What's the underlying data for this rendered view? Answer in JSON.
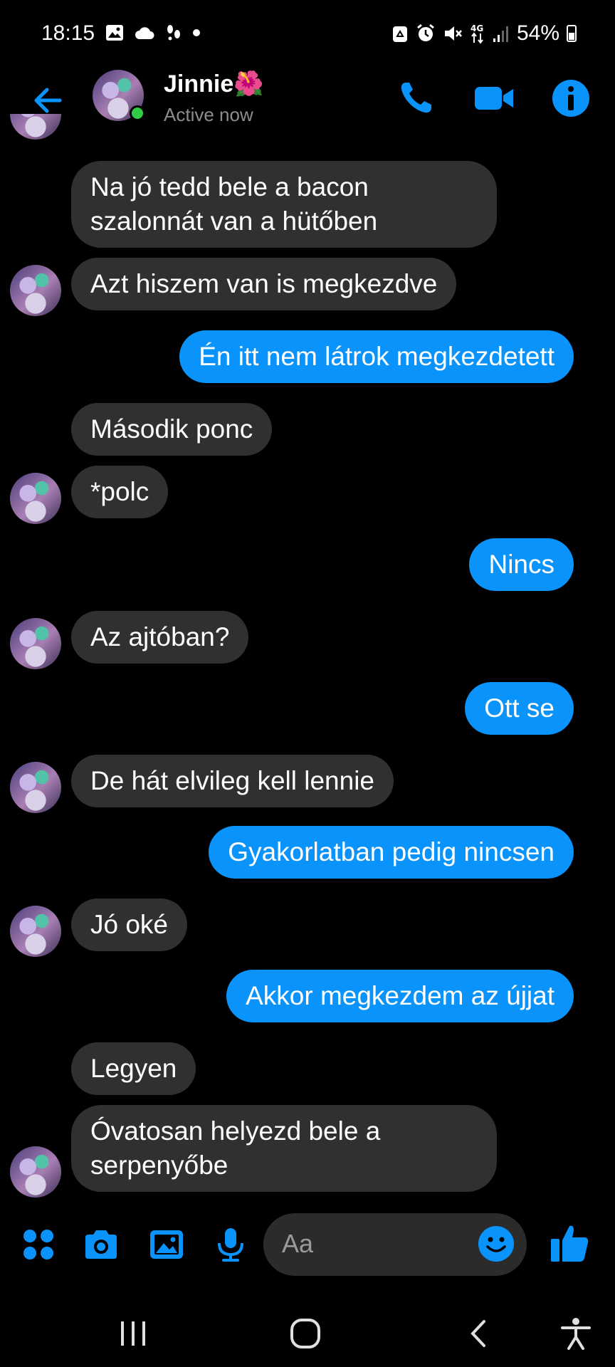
{
  "status_bar": {
    "time": "18:15",
    "battery": "54%",
    "network": "4G"
  },
  "header": {
    "contact_name": "Jinnie🌺",
    "status": "Active now"
  },
  "messages": [
    {
      "side": "in",
      "text": "Na jó tedd bele a bacon\nszalonnát van a hütőben"
    },
    {
      "side": "in",
      "text": "Azt hiszem van is megkezdve"
    },
    {
      "side": "out",
      "text": "Én itt nem látrok megkezdetett"
    },
    {
      "side": "in",
      "text": "Második ponc"
    },
    {
      "side": "in",
      "text": "*polc"
    },
    {
      "side": "out",
      "text": "Nincs"
    },
    {
      "side": "in",
      "text": "Az ajtóban?"
    },
    {
      "side": "out",
      "text": "Ott se"
    },
    {
      "side": "in",
      "text": "De hát elvileg kell lennie"
    },
    {
      "side": "out",
      "text": "Gyakorlatban pedig nincsen"
    },
    {
      "side": "in",
      "text": "Jó oké"
    },
    {
      "side": "out",
      "text": "Akkor megkezdem az újjat"
    },
    {
      "side": "in",
      "text": "Legyen"
    },
    {
      "side": "in",
      "text": "Óvatosan helyezd bele a\nserpenyőbe"
    }
  ],
  "composer": {
    "placeholder": "Aa"
  },
  "colors": {
    "accent": "#0a93fa",
    "incoming_bubble": "#303030",
    "online": "#31cc46"
  }
}
